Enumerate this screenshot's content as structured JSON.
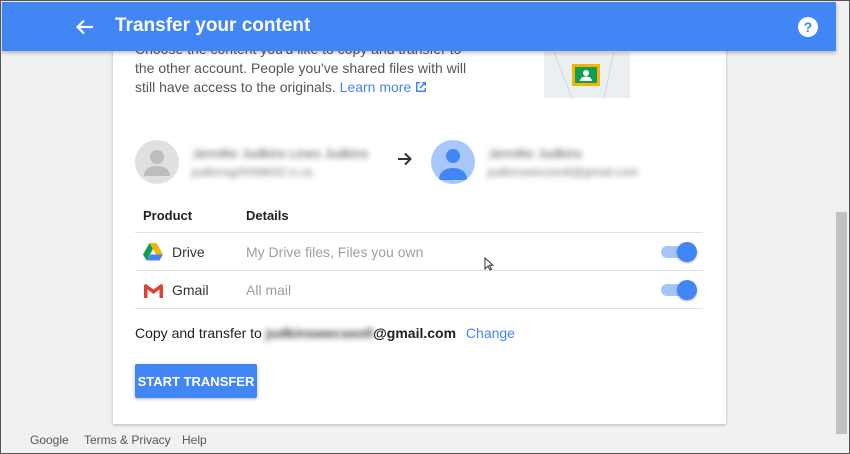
{
  "header": {
    "title": "Transfer your content",
    "help_label": "?"
  },
  "description": {
    "line1": "Choose the content you'd like to copy and transfer to",
    "line2": "the other account. People you've shared files with will",
    "line3_prefix": "still have access to the originals. ",
    "learn_more": "Learn more"
  },
  "accounts": {
    "source": {
      "name": "Jennifer Judkins Lines Judkins",
      "email": "judkinsgrfrhfdkhl2.n.ca"
    },
    "destination": {
      "name": "Jennifer Judkins",
      "email": "judkinswecseoll@gmail.com"
    }
  },
  "table": {
    "headers": {
      "product": "Product",
      "details": "Details"
    },
    "rows": [
      {
        "product": "Drive",
        "details": "My Drive files, Files you own",
        "icon": "drive-icon",
        "enabled": true
      },
      {
        "product": "Gmail",
        "details": "All mail",
        "icon": "gmail-icon",
        "enabled": true
      }
    ]
  },
  "copy": {
    "prefix": "Copy and transfer to ",
    "email_hidden": "judkinswecseoll",
    "email_domain": "@gmail.com",
    "change": "Change"
  },
  "start_button": "START TRANSFER",
  "footer": {
    "google": "Google",
    "terms": "Terms & Privacy",
    "help": "Help"
  },
  "colors": {
    "primary": "#4285f4",
    "toggle_track": "#a5c4f8",
    "background": "#f1f1f1"
  }
}
